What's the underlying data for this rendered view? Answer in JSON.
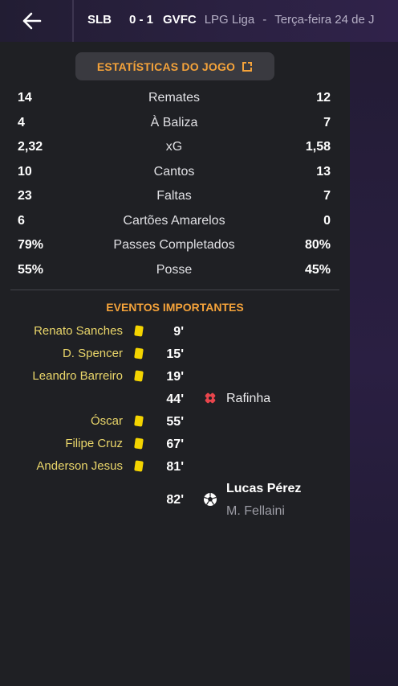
{
  "header": {
    "home_team": "SLB",
    "score": "0 - 1",
    "away_team": "GVFC",
    "competition": "LPG Liga",
    "separator": "-",
    "date": "Terça-feira 24 de J"
  },
  "stats_button": {
    "label": "ESTATÍSTICAS DO JOGO"
  },
  "stats": [
    {
      "home": "14",
      "label": "Remates",
      "away": "12"
    },
    {
      "home": "4",
      "label": "À Baliza",
      "away": "7"
    },
    {
      "home": "2,32",
      "label": "xG",
      "away": "1,58"
    },
    {
      "home": "10",
      "label": "Cantos",
      "away": "13"
    },
    {
      "home": "23",
      "label": "Faltas",
      "away": "7"
    },
    {
      "home": "6",
      "label": "Cartões Amarelos",
      "away": "0"
    },
    {
      "home": "79%",
      "label": "Passes Completados",
      "away": "80%"
    },
    {
      "home": "55%",
      "label": "Posse",
      "away": "45%"
    }
  ],
  "events": {
    "title": "EVENTOS IMPORTANTES",
    "items": [
      {
        "player": "Renato Sanches",
        "minute": "9'",
        "icon": "yellow-card-icon"
      },
      {
        "player": "D. Spencer",
        "minute": "15'",
        "icon": "yellow-card-icon"
      },
      {
        "player": "Leandro Barreiro",
        "minute": "19'",
        "icon": "yellow-card-icon"
      },
      {
        "minute": "44'",
        "icon": "injury-icon",
        "away_player": "Rafinha"
      },
      {
        "player": "Óscar",
        "minute": "55'",
        "icon": "yellow-card-icon"
      },
      {
        "player": "Filipe Cruz",
        "minute": "67'",
        "icon": "yellow-card-icon"
      },
      {
        "player": "Anderson Jesus",
        "minute": "81'",
        "icon": "yellow-card-icon"
      },
      {
        "minute": "82'",
        "icon": "goal-ball-icon",
        "scorer": "Lucas Pérez",
        "assist": "M. Fellaini"
      }
    ]
  },
  "colors": {
    "accent": "#f5a33a",
    "yellow_card": "#f4d400",
    "home_event_text": "#ead66a",
    "injury": "#e8454c"
  }
}
